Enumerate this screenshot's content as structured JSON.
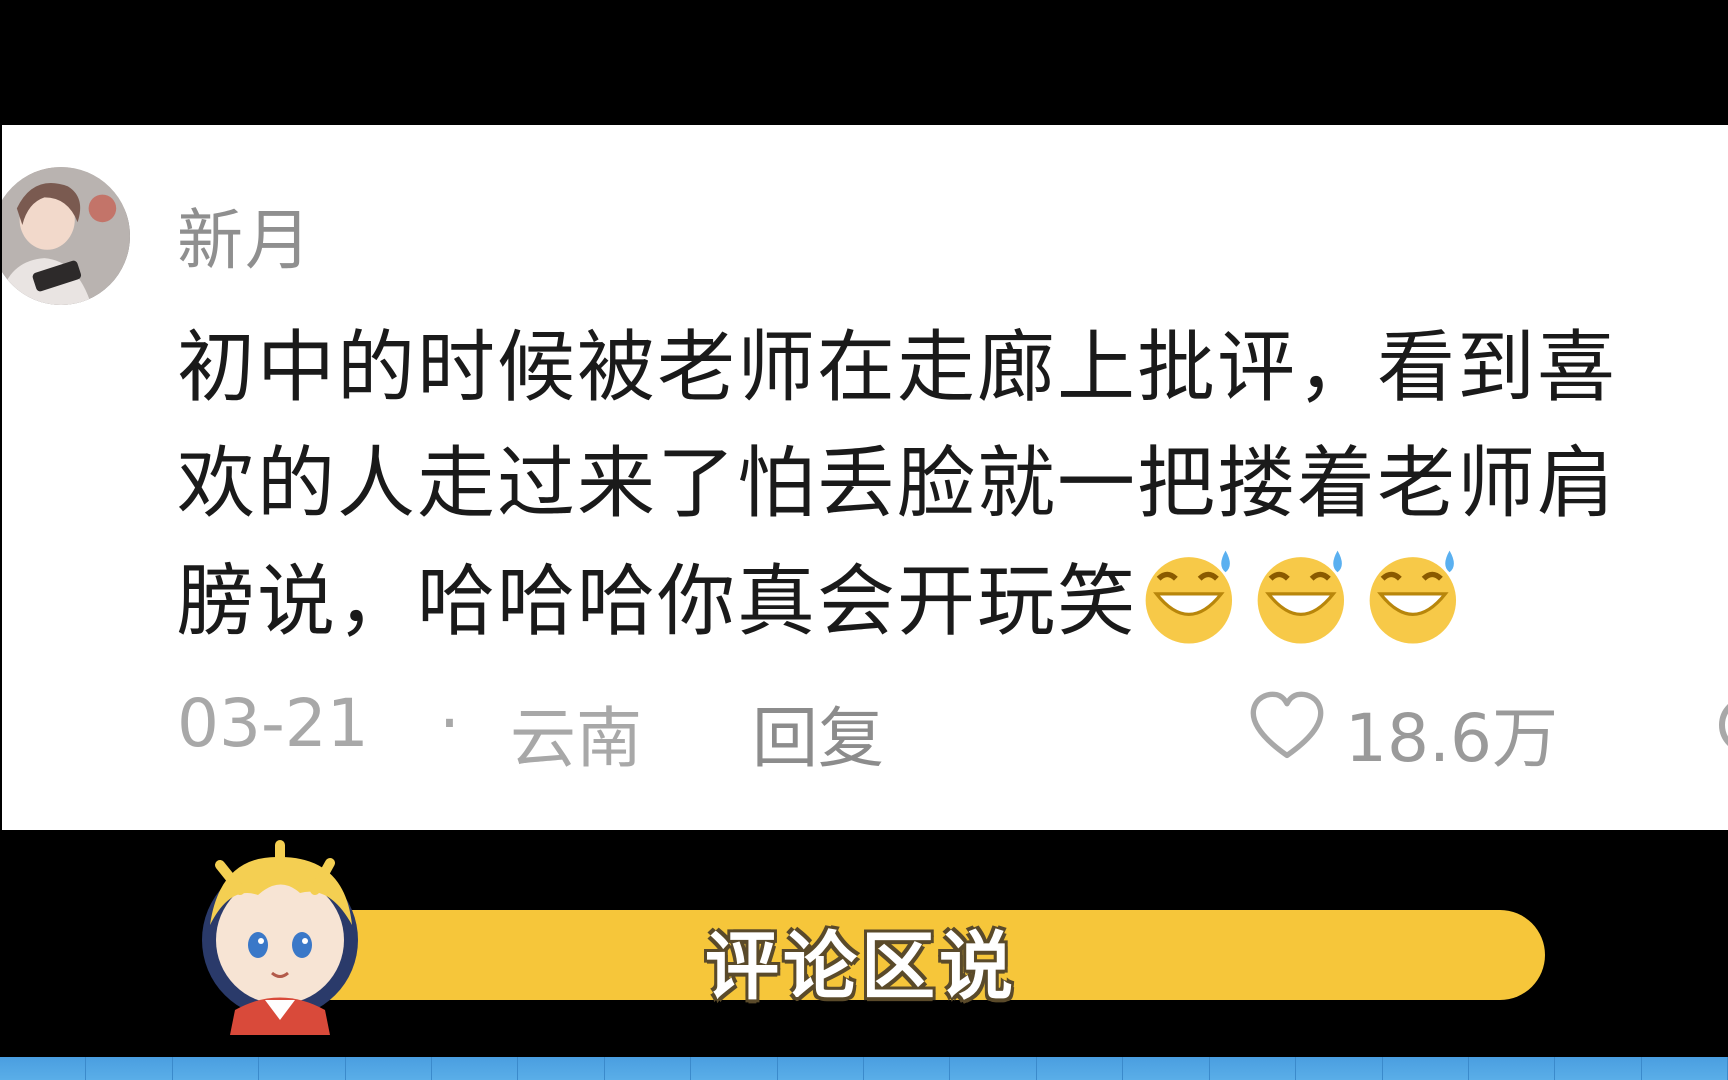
{
  "comment": {
    "username": "新月",
    "lines": [
      "初中的时候被老师在走廊上批评，看到喜",
      "欢的人走过来了怕丢脸就一把搂着老师肩",
      "膀说，哈哈哈你真会开玩笑"
    ],
    "emojis": [
      "grinning-sweat-emoji",
      "grinning-sweat-emoji",
      "grinning-sweat-emoji"
    ],
    "date": "03-21",
    "separator": "·",
    "location": "云南",
    "reply_label": "回复",
    "like_count": "18.6万"
  },
  "banner": {
    "text": "评论区说",
    "color": "#f6c63a"
  },
  "icons": {
    "like": "heart-outline-icon",
    "more": "comment-icon"
  },
  "colors": {
    "background": "#000000",
    "card": "#ffffff",
    "strip": "#4a9ee0"
  }
}
